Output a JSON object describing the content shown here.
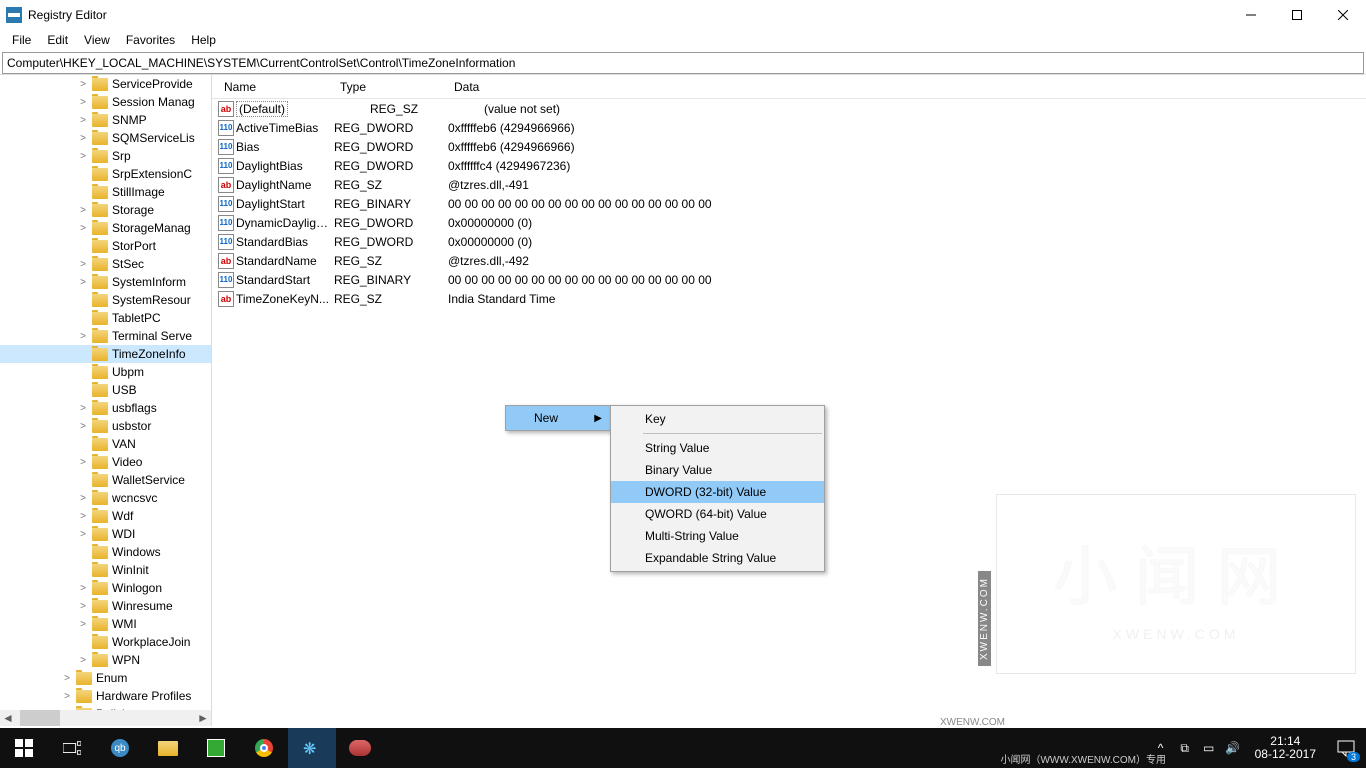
{
  "window": {
    "title": "Registry Editor"
  },
  "menu": {
    "file": "File",
    "edit": "Edit",
    "view": "View",
    "favorites": "Favorites",
    "help": "Help"
  },
  "address": {
    "path": "Computer\\HKEY_LOCAL_MACHINE\\SYSTEM\\CurrentControlSet\\Control\\TimeZoneInformation"
  },
  "tree": {
    "items": [
      {
        "label": "ServiceProvide",
        "exp": ">",
        "depth": 2
      },
      {
        "label": "Session Manag",
        "exp": ">",
        "depth": 2
      },
      {
        "label": "SNMP",
        "exp": ">",
        "depth": 2
      },
      {
        "label": "SQMServiceLis",
        "exp": ">",
        "depth": 2
      },
      {
        "label": "Srp",
        "exp": ">",
        "depth": 2
      },
      {
        "label": "SrpExtensionC",
        "exp": "",
        "depth": 2
      },
      {
        "label": "StillImage",
        "exp": "",
        "depth": 2
      },
      {
        "label": "Storage",
        "exp": ">",
        "depth": 2
      },
      {
        "label": "StorageManag",
        "exp": ">",
        "depth": 2
      },
      {
        "label": "StorPort",
        "exp": "",
        "depth": 2
      },
      {
        "label": "StSec",
        "exp": ">",
        "depth": 2
      },
      {
        "label": "SystemInform",
        "exp": ">",
        "depth": 2
      },
      {
        "label": "SystemResour",
        "exp": "",
        "depth": 2
      },
      {
        "label": "TabletPC",
        "exp": "",
        "depth": 2
      },
      {
        "label": "Terminal Serve",
        "exp": ">",
        "depth": 2
      },
      {
        "label": "TimeZoneInfo",
        "exp": "",
        "depth": 2,
        "selected": true
      },
      {
        "label": "Ubpm",
        "exp": "",
        "depth": 2
      },
      {
        "label": "USB",
        "exp": "",
        "depth": 2
      },
      {
        "label": "usbflags",
        "exp": ">",
        "depth": 2
      },
      {
        "label": "usbstor",
        "exp": ">",
        "depth": 2
      },
      {
        "label": "VAN",
        "exp": "",
        "depth": 2
      },
      {
        "label": "Video",
        "exp": ">",
        "depth": 2
      },
      {
        "label": "WalletService",
        "exp": "",
        "depth": 2
      },
      {
        "label": "wcncsvc",
        "exp": ">",
        "depth": 2
      },
      {
        "label": "Wdf",
        "exp": ">",
        "depth": 2
      },
      {
        "label": "WDI",
        "exp": ">",
        "depth": 2
      },
      {
        "label": "Windows",
        "exp": "",
        "depth": 2
      },
      {
        "label": "WinInit",
        "exp": "",
        "depth": 2
      },
      {
        "label": "Winlogon",
        "exp": ">",
        "depth": 2
      },
      {
        "label": "Winresume",
        "exp": ">",
        "depth": 2
      },
      {
        "label": "WMI",
        "exp": ">",
        "depth": 2
      },
      {
        "label": "WorkplaceJoin",
        "exp": "",
        "depth": 2
      },
      {
        "label": "WPN",
        "exp": ">",
        "depth": 2
      },
      {
        "label": "Enum",
        "exp": ">",
        "depth": 1
      },
      {
        "label": "Hardware Profiles",
        "exp": ">",
        "depth": 1
      },
      {
        "label": "Policies",
        "exp": ">",
        "depth": 1
      }
    ]
  },
  "columns": {
    "name": "Name",
    "type": "Type",
    "data": "Data"
  },
  "values": [
    {
      "icon": "sz",
      "name": "(Default)",
      "type": "REG_SZ",
      "data": "(value not set)",
      "default": true
    },
    {
      "icon": "bin",
      "name": "ActiveTimeBias",
      "type": "REG_DWORD",
      "data": "0xfffffeb6 (4294966966)"
    },
    {
      "icon": "bin",
      "name": "Bias",
      "type": "REG_DWORD",
      "data": "0xfffffeb6 (4294966966)"
    },
    {
      "icon": "bin",
      "name": "DaylightBias",
      "type": "REG_DWORD",
      "data": "0xffffffc4 (4294967236)"
    },
    {
      "icon": "sz",
      "name": "DaylightName",
      "type": "REG_SZ",
      "data": "@tzres.dll,-491"
    },
    {
      "icon": "bin",
      "name": "DaylightStart",
      "type": "REG_BINARY",
      "data": "00 00 00 00 00 00 00 00 00 00 00 00 00 00 00 00"
    },
    {
      "icon": "bin",
      "name": "DynamicDaylight...",
      "type": "REG_DWORD",
      "data": "0x00000000 (0)"
    },
    {
      "icon": "bin",
      "name": "StandardBias",
      "type": "REG_DWORD",
      "data": "0x00000000 (0)"
    },
    {
      "icon": "sz",
      "name": "StandardName",
      "type": "REG_SZ",
      "data": "@tzres.dll,-492"
    },
    {
      "icon": "bin",
      "name": "StandardStart",
      "type": "REG_BINARY",
      "data": "00 00 00 00 00 00 00 00 00 00 00 00 00 00 00 00"
    },
    {
      "icon": "sz",
      "name": "TimeZoneKeyN...",
      "type": "REG_SZ",
      "data": "India Standard Time"
    }
  ],
  "ctxmenu": {
    "primary": {
      "new": "New"
    },
    "submenu": {
      "key": "Key",
      "string": "String Value",
      "binary": "Binary Value",
      "dword": "DWORD (32-bit) Value",
      "qword": "QWORD (64-bit) Value",
      "multi": "Multi-String Value",
      "expand": "Expandable String Value"
    }
  },
  "taskbar": {
    "time": "21:14",
    "date": "08-12-2017",
    "notif_count": "3"
  },
  "watermark": {
    "big": "小闻网",
    "domain": "XWENW.COM",
    "side": "XWENW.COM",
    "bar": "小闻网（WWW.XWENW.COM）专用"
  }
}
